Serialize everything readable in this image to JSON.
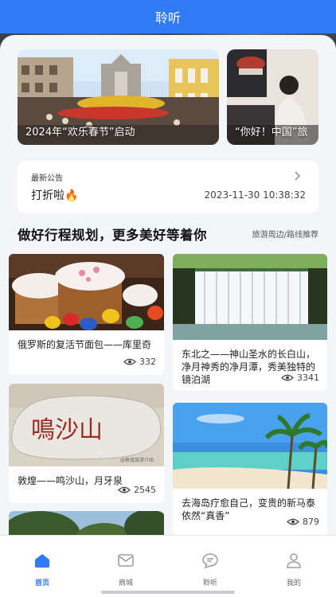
{
  "app": {
    "title": "聆听"
  },
  "banner": [
    {
      "caption": "2024年“欢乐春节”启动",
      "scene": "macau-ruins-festival"
    },
    {
      "caption": "“你好！中国”旅",
      "scene": "woman-tea"
    }
  ],
  "notice": {
    "label": "最新公告",
    "text": "打折啦🔥",
    "time": "2023-11-30 10:38:32"
  },
  "section": {
    "title": "做好行程规划，更多美好等着你",
    "tag": "旅游周边/路线推荐"
  },
  "feed": [
    {
      "title": "俄罗斯的复活节面包——库里奇",
      "views": "332",
      "image": "easter-bread"
    },
    {
      "title": "东北之——神山圣水的长白山，净月神秀的净月潭，秀美独特的镜泊湖",
      "views": "3341",
      "image": "waterfall"
    },
    {
      "title": "敦煌——鸣沙山，月牙泉",
      "views": "2545",
      "image": "sand-rock"
    },
    {
      "title": "去海岛疗愈自己，变贵的新马泰依然“真香”",
      "views": "879",
      "image": "island-beach"
    },
    {
      "title": "",
      "views": "",
      "image": "trees"
    }
  ],
  "image_text": {
    "rock_inscription": "鳴沙山",
    "watermark": "@敦煌旅游介绍"
  },
  "tabbar": [
    {
      "label": "首页",
      "icon": "home-icon",
      "active": true
    },
    {
      "label": "商城",
      "icon": "mail-icon",
      "active": false
    },
    {
      "label": "聆听",
      "icon": "chat-bubble-icon",
      "active": false
    },
    {
      "label": "我的",
      "icon": "person-icon",
      "active": false
    }
  ],
  "colors": {
    "accent": "#2f7cf6",
    "page_bg": "#f3f5f9"
  }
}
